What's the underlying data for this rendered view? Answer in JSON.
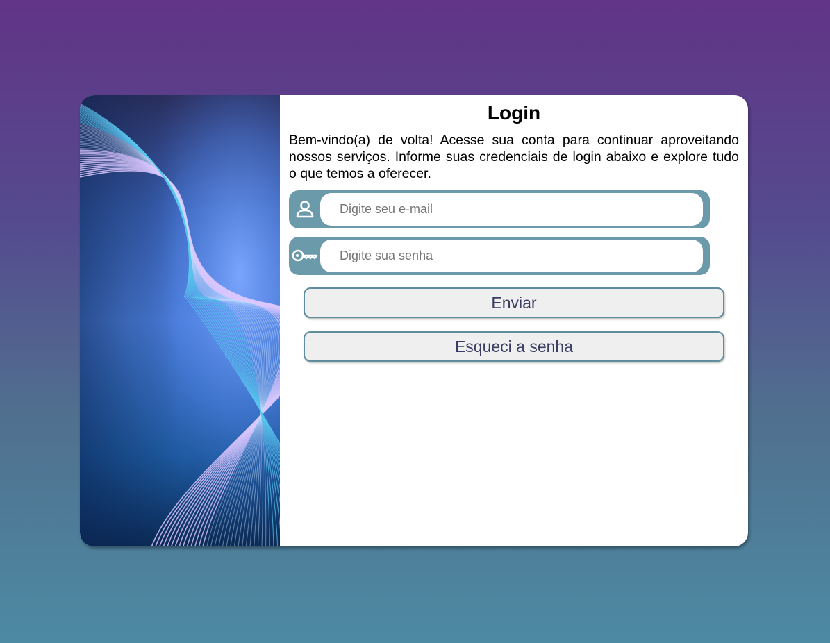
{
  "login": {
    "title": "Login",
    "intro": "Bem-vindo(a) de volta! Acesse sua conta para continuar aproveitando nossos serviços. Informe suas credenciais de login abaixo e explore tudo o que temos a oferecer.",
    "email": {
      "placeholder": "Digite seu e-mail",
      "value": "",
      "icon": "user-icon"
    },
    "password": {
      "placeholder": "Digite sua senha",
      "value": "",
      "icon": "key-icon"
    },
    "submit_label": "Enviar",
    "forgot_label": "Esqueci a senha"
  },
  "colors": {
    "field_accent": "#6b9aab",
    "button_border": "#5e8d9c",
    "button_text": "#3b3d63",
    "background_top": "#613487",
    "background_bottom": "#4d8aa3"
  }
}
